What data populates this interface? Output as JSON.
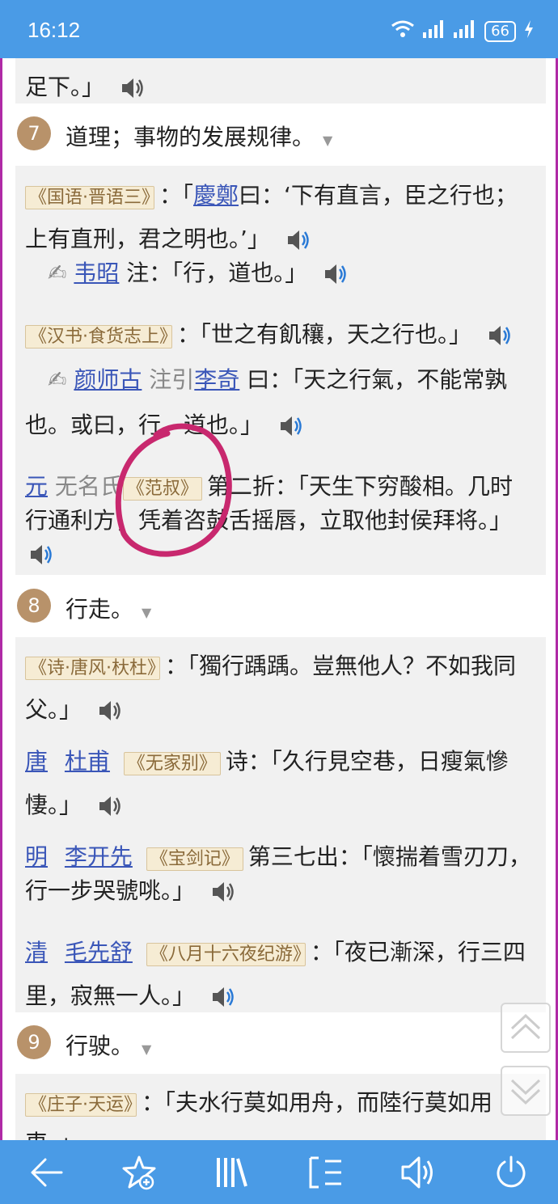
{
  "status": {
    "time": "16:12",
    "battery": "66"
  },
  "top_partial": {
    "text": "足下。」"
  },
  "sense7": {
    "number": "7",
    "label": "道理；事物的发展规律。"
  },
  "s7": {
    "q1_src": "《国语·晋语三》",
    "q1_a": "：「",
    "q1_person": "慶鄭",
    "q1_b": "曰：‘下有直言，臣之行也；",
    "q1_c": "上有直刑，君之明也。’」",
    "n1_person": "韦昭",
    "n1_text": " 注：「行，道也。」",
    "q2_src": "《汉书·食货志上》",
    "q2_a": "：「世之有飢穰，天之行也。」",
    "n2_person": "颜师古",
    "n2_mid": " 注引",
    "n2_person2": "李奇",
    "n2_text": " 曰：「天之行氣，不能常孰",
    "n2_text2": "也。或曰，行，道也。」",
    "q3_dyn": "元",
    "q3_author": " 无名氏",
    "q3_src": "《范叔》",
    "q3_a": "第二折：「天生下穷酸相。几时",
    "q3_b": "行通利方，凭着咨鼓舌摇唇，立取他封侯拜将。」"
  },
  "sense8": {
    "number": "8",
    "label": "行走。"
  },
  "s8": {
    "q1_src": "《诗·唐风·杕杜》",
    "q1_a": "：「獨行踽踽。豈無他人？不如我同",
    "q1_b": "父。」",
    "q2_dyn": "唐",
    "q2_author": "杜甫",
    "q2_src": "《无家别》",
    "q2_a": "诗：「久行見空巷，日瘦氣慘",
    "q2_b": "悽。」",
    "q3_dyn": "明",
    "q3_author": "李开先",
    "q3_src": "《宝剑记》",
    "q3_a": "第三七出：「懷揣着雪刃刀，",
    "q3_b": "行一步哭號咷。」",
    "q4_dyn": "清",
    "q4_author": "毛先舒",
    "q4_src": "《八月十六夜纪游》",
    "q4_a": "：「夜已漸深，行三四",
    "q4_b": "里，寂無一人。」"
  },
  "sense9": {
    "number": "9",
    "label": "行驶。"
  },
  "s9": {
    "q1_src": "《庄子·天运》",
    "q1_a": "：「夫水行莫如用舟，而陸行莫如用",
    "q1_b": "車。」"
  },
  "nav": {
    "icons": [
      "back-arrow-icon",
      "favorite-add-icon",
      "library-icon",
      "contents-list-icon",
      "speaker-icon",
      "power-icon"
    ]
  },
  "colors": {
    "accent": "#4a9be6",
    "annotation": "#c8286e",
    "badge": "#b8926a",
    "link": "#3a56b8"
  }
}
